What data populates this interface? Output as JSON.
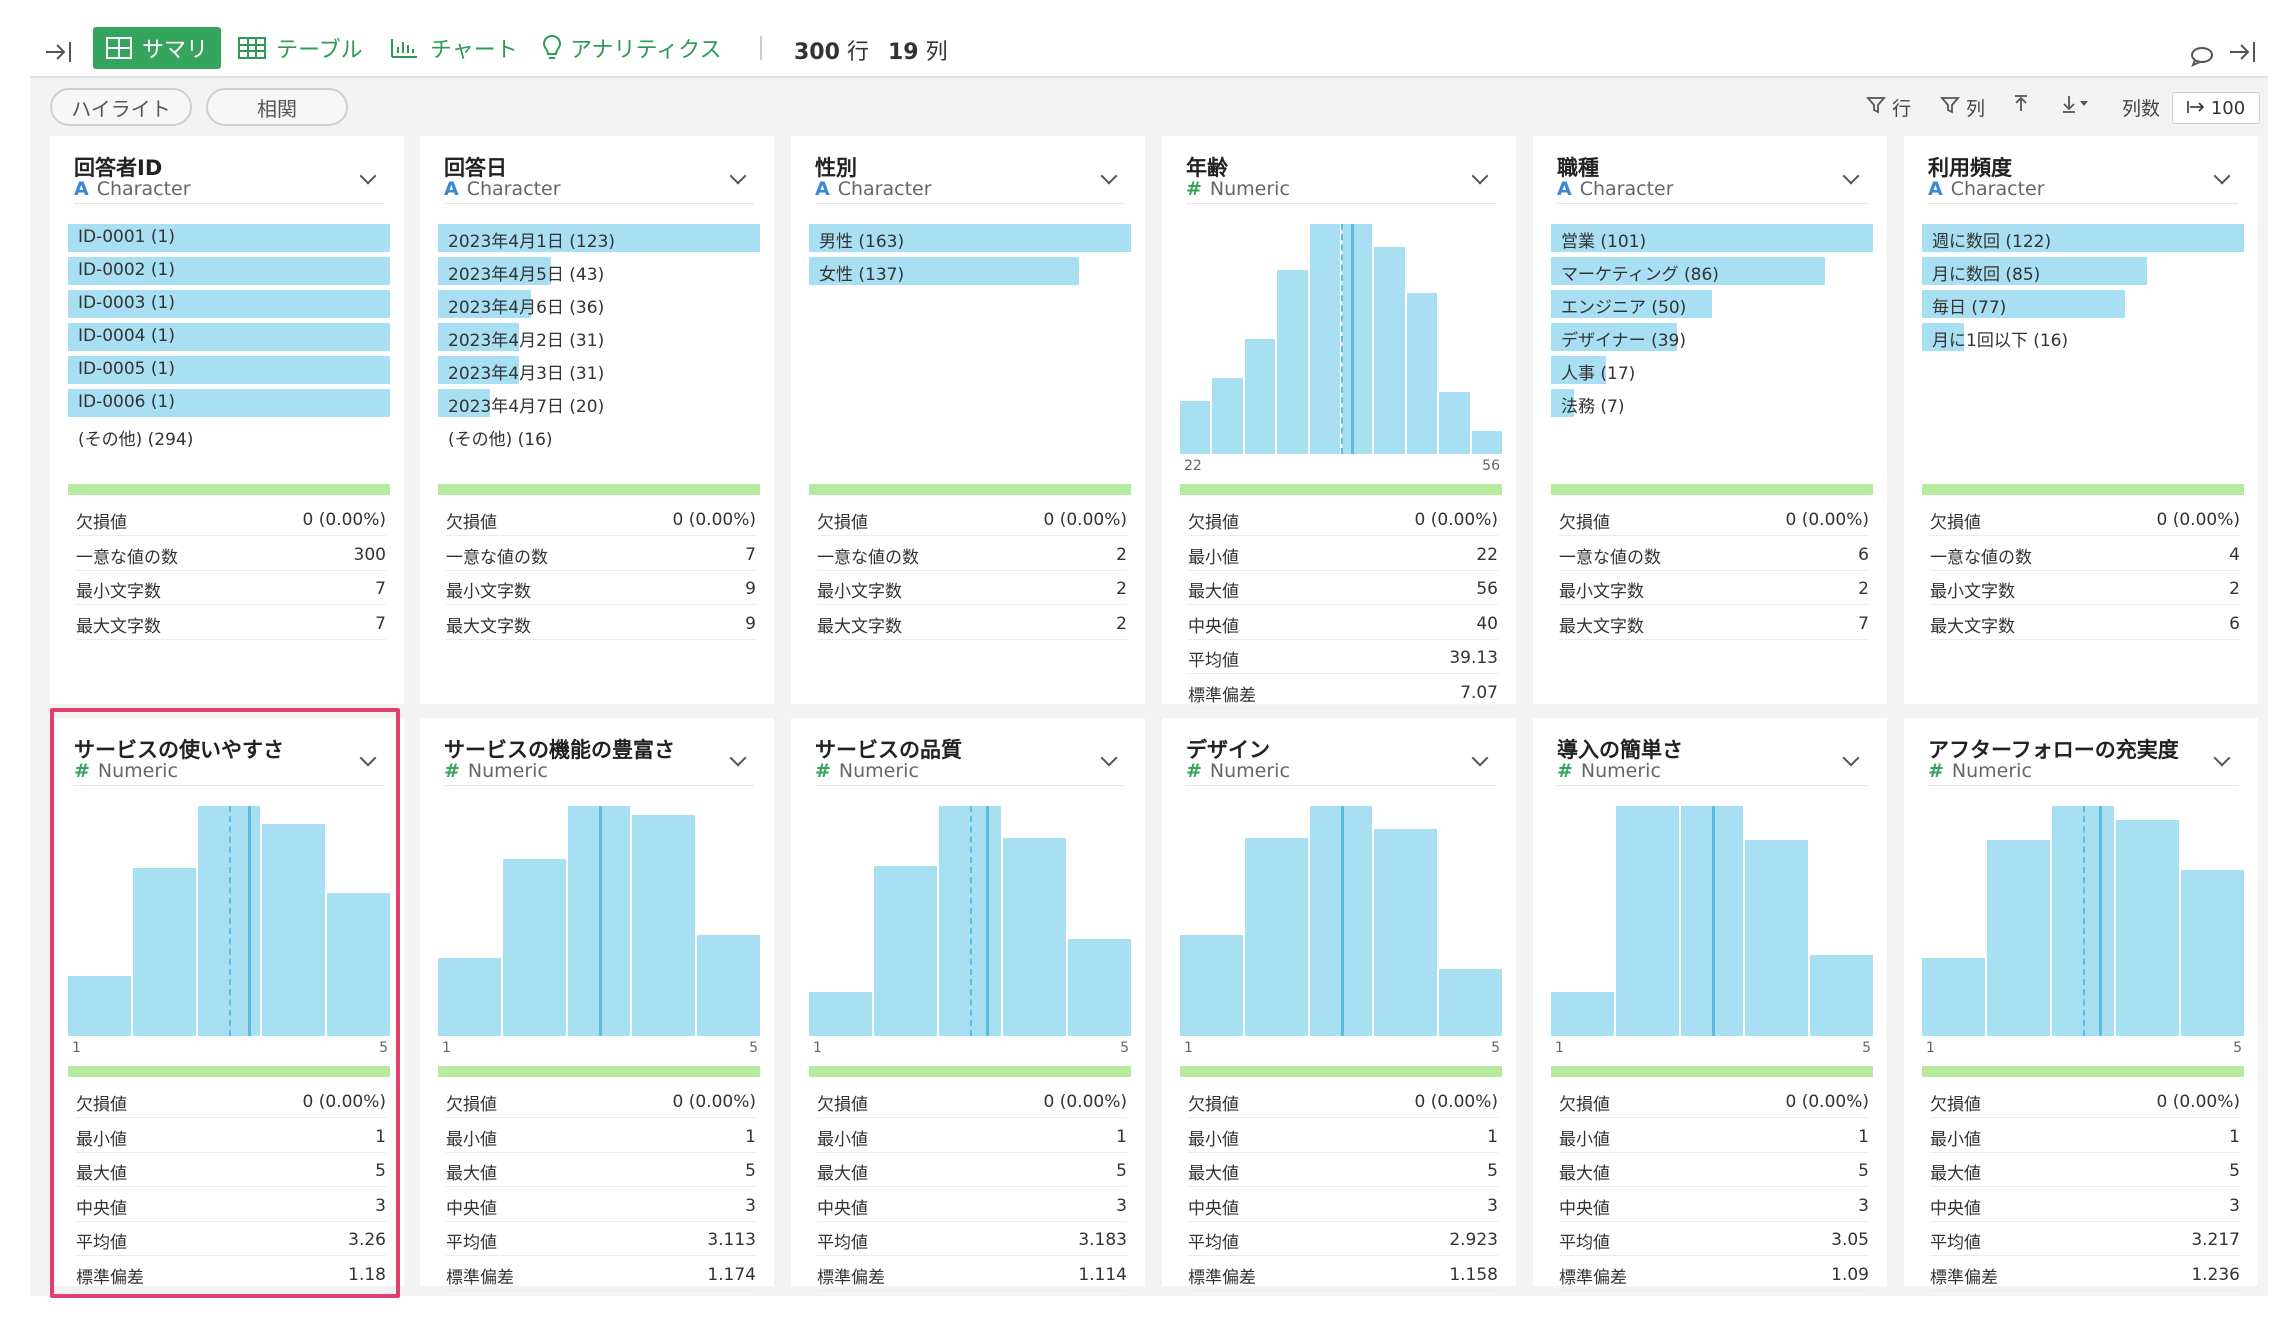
{
  "toolbar": {
    "tabs": [
      {
        "label": "サマリ",
        "icon": "grid-icon",
        "active": true
      },
      {
        "label": "テーブル",
        "icon": "table-icon",
        "active": false
      },
      {
        "label": "チャート",
        "icon": "bar-chart-icon",
        "active": false
      },
      {
        "label": "アナリティクス",
        "icon": "lightbulb-icon",
        "active": false
      }
    ],
    "rows_value": "300",
    "rows_unit": "行",
    "cols_value": "19",
    "cols_unit": "列"
  },
  "subbar": {
    "highlight_label": "ハイライト",
    "correlation_label": "相関",
    "filter_row_label": "行",
    "filter_col_label": "列",
    "col_count_label": "列数",
    "col_count_value": "100"
  },
  "colors": {
    "accent": "#35a45c",
    "bar": "#a9dff2",
    "null_bar": "#b6ea9f",
    "highlight_border": "#e2406c",
    "character_type": "#3a87d8"
  },
  "cards": [
    {
      "title": "回答者ID",
      "type_icon": "A",
      "type": "Character",
      "categories": [
        {
          "label": "ID-0001 (1)",
          "fraction": 1.0
        },
        {
          "label": "ID-0002 (1)",
          "fraction": 1.0
        },
        {
          "label": "ID-0003 (1)",
          "fraction": 1.0
        },
        {
          "label": "ID-0004 (1)",
          "fraction": 1.0
        },
        {
          "label": "ID-0005 (1)",
          "fraction": 1.0
        },
        {
          "label": "ID-0006 (1)",
          "fraction": 1.0
        }
      ],
      "other": "(その他) (294)",
      "stats": [
        {
          "label": "欠損値",
          "value": "0 (0.00%)"
        },
        {
          "label": "一意な値の数",
          "value": "300"
        },
        {
          "label": "最小文字数",
          "value": "7"
        },
        {
          "label": "最大文字数",
          "value": "7"
        }
      ]
    },
    {
      "title": "回答日",
      "type_icon": "A",
      "type": "Character",
      "categories": [
        {
          "label": "2023年4月1日 (123)",
          "fraction": 1.0
        },
        {
          "label": "2023年4月5日 (43)",
          "fraction": 0.35
        },
        {
          "label": "2023年4月6日 (36)",
          "fraction": 0.29
        },
        {
          "label": "2023年4月2日 (31)",
          "fraction": 0.25
        },
        {
          "label": "2023年4月3日 (31)",
          "fraction": 0.25
        },
        {
          "label": "2023年4月7日 (20)",
          "fraction": 0.16
        }
      ],
      "other": "(その他) (16)",
      "stats": [
        {
          "label": "欠損値",
          "value": "0 (0.00%)"
        },
        {
          "label": "一意な値の数",
          "value": "7"
        },
        {
          "label": "最小文字数",
          "value": "9"
        },
        {
          "label": "最大文字数",
          "value": "9"
        }
      ]
    },
    {
      "title": "性別",
      "type_icon": "A",
      "type": "Character",
      "categories": [
        {
          "label": "男性 (163)",
          "fraction": 1.0
        },
        {
          "label": "女性 (137)",
          "fraction": 0.84
        }
      ],
      "other": "",
      "stats": [
        {
          "label": "欠損値",
          "value": "0 (0.00%)"
        },
        {
          "label": "一意な値の数",
          "value": "2"
        },
        {
          "label": "最小文字数",
          "value": "2"
        },
        {
          "label": "最大文字数",
          "value": "2"
        }
      ]
    },
    {
      "title": "年齢",
      "type_icon": "#",
      "type": "Numeric",
      "hist": {
        "bins": [
          0.23,
          0.33,
          0.5,
          0.8,
          1.0,
          1.0,
          0.9,
          0.7,
          0.27,
          0.1
        ],
        "min_label": "22",
        "max_label": "56",
        "mean_frac": 0.5,
        "median_frac": 0.53
      },
      "stats": [
        {
          "label": "欠損値",
          "value": "0 (0.00%)"
        },
        {
          "label": "最小値",
          "value": "22"
        },
        {
          "label": "最大値",
          "value": "56"
        },
        {
          "label": "中央値",
          "value": "40"
        },
        {
          "label": "平均値",
          "value": "39.13"
        },
        {
          "label": "標準偏差",
          "value": "7.07"
        }
      ]
    },
    {
      "title": "職種",
      "type_icon": "A",
      "type": "Character",
      "categories": [
        {
          "label": "営業 (101)",
          "fraction": 1.0
        },
        {
          "label": "マーケティング (86)",
          "fraction": 0.85
        },
        {
          "label": "エンジニア (50)",
          "fraction": 0.5
        },
        {
          "label": "デザイナー (39)",
          "fraction": 0.39
        },
        {
          "label": "人事 (17)",
          "fraction": 0.17
        },
        {
          "label": "法務 (7)",
          "fraction": 0.07
        }
      ],
      "other": "",
      "stats": [
        {
          "label": "欠損値",
          "value": "0 (0.00%)"
        },
        {
          "label": "一意な値の数",
          "value": "6"
        },
        {
          "label": "最小文字数",
          "value": "2"
        },
        {
          "label": "最大文字数",
          "value": "7"
        }
      ]
    },
    {
      "title": "利用頻度",
      "type_icon": "A",
      "type": "Character",
      "categories": [
        {
          "label": "週に数回 (122)",
          "fraction": 1.0
        },
        {
          "label": "月に数回 (85)",
          "fraction": 0.7
        },
        {
          "label": "毎日 (77)",
          "fraction": 0.63
        },
        {
          "label": "月に1回以下 (16)",
          "fraction": 0.13
        }
      ],
      "other": "",
      "stats": [
        {
          "label": "欠損値",
          "value": "0 (0.00%)"
        },
        {
          "label": "一意な値の数",
          "value": "4"
        },
        {
          "label": "最小文字数",
          "value": "2"
        },
        {
          "label": "最大文字数",
          "value": "6"
        }
      ]
    },
    {
      "title": "サービスの使いやすさ",
      "type_icon": "#",
      "type": "Numeric",
      "highlighted": true,
      "hist": {
        "bins": [
          0.26,
          0.73,
          1.0,
          0.92,
          0.62
        ],
        "min_label": "1",
        "max_label": "5",
        "mean_frac": 0.5,
        "median_frac": 0.56
      },
      "stats": [
        {
          "label": "欠損値",
          "value": "0 (0.00%)"
        },
        {
          "label": "最小値",
          "value": "1"
        },
        {
          "label": "最大値",
          "value": "5"
        },
        {
          "label": "中央値",
          "value": "3"
        },
        {
          "label": "平均値",
          "value": "3.26"
        },
        {
          "label": "標準偏差",
          "value": "1.18"
        }
      ]
    },
    {
      "title": "サービスの機能の豊富さ",
      "type_icon": "#",
      "type": "Numeric",
      "hist": {
        "bins": [
          0.34,
          0.77,
          1.0,
          0.96,
          0.44
        ],
        "min_label": "1",
        "max_label": "5",
        "mean_frac": 0.5,
        "median_frac": 0.5
      },
      "stats": [
        {
          "label": "欠損値",
          "value": "0 (0.00%)"
        },
        {
          "label": "最小値",
          "value": "1"
        },
        {
          "label": "最大値",
          "value": "5"
        },
        {
          "label": "中央値",
          "value": "3"
        },
        {
          "label": "平均値",
          "value": "3.113"
        },
        {
          "label": "標準偏差",
          "value": "1.174"
        }
      ]
    },
    {
      "title": "サービスの品質",
      "type_icon": "#",
      "type": "Numeric",
      "hist": {
        "bins": [
          0.19,
          0.74,
          1.0,
          0.86,
          0.42
        ],
        "min_label": "1",
        "max_label": "5",
        "mean_frac": 0.5,
        "median_frac": 0.55
      },
      "stats": [
        {
          "label": "欠損値",
          "value": "0 (0.00%)"
        },
        {
          "label": "最小値",
          "value": "1"
        },
        {
          "label": "最大値",
          "value": "5"
        },
        {
          "label": "中央値",
          "value": "3"
        },
        {
          "label": "平均値",
          "value": "3.183"
        },
        {
          "label": "標準偏差",
          "value": "1.114"
        }
      ]
    },
    {
      "title": "デザイン",
      "type_icon": "#",
      "type": "Numeric",
      "hist": {
        "bins": [
          0.44,
          0.86,
          1.0,
          0.9,
          0.29
        ],
        "min_label": "1",
        "max_label": "5",
        "mean_frac": 0.5,
        "median_frac": 0.5
      },
      "stats": [
        {
          "label": "欠損値",
          "value": "0 (0.00%)"
        },
        {
          "label": "最小値",
          "value": "1"
        },
        {
          "label": "最大値",
          "value": "5"
        },
        {
          "label": "中央値",
          "value": "3"
        },
        {
          "label": "平均値",
          "value": "2.923"
        },
        {
          "label": "標準偏差",
          "value": "1.158"
        }
      ]
    },
    {
      "title": "導入の簡単さ",
      "type_icon": "#",
      "type": "Numeric",
      "hist": {
        "bins": [
          0.19,
          1.0,
          1.0,
          0.85,
          0.35
        ],
        "min_label": "1",
        "max_label": "5",
        "mean_frac": 0.5,
        "median_frac": 0.5
      },
      "stats": [
        {
          "label": "欠損値",
          "value": "0 (0.00%)"
        },
        {
          "label": "最小値",
          "value": "1"
        },
        {
          "label": "最大値",
          "value": "5"
        },
        {
          "label": "中央値",
          "value": "3"
        },
        {
          "label": "平均値",
          "value": "3.05"
        },
        {
          "label": "標準偏差",
          "value": "1.09"
        }
      ]
    },
    {
      "title": "アフターフォローの充実度",
      "type_icon": "#",
      "type": "Numeric",
      "hist": {
        "bins": [
          0.34,
          0.85,
          1.0,
          0.94,
          0.72
        ],
        "min_label": "1",
        "max_label": "5",
        "mean_frac": 0.5,
        "median_frac": 0.55
      },
      "stats": [
        {
          "label": "欠損値",
          "value": "0 (0.00%)"
        },
        {
          "label": "最小値",
          "value": "1"
        },
        {
          "label": "最大値",
          "value": "5"
        },
        {
          "label": "中央値",
          "value": "3"
        },
        {
          "label": "平均値",
          "value": "3.217"
        },
        {
          "label": "標準偏差",
          "value": "1.236"
        }
      ]
    }
  ]
}
